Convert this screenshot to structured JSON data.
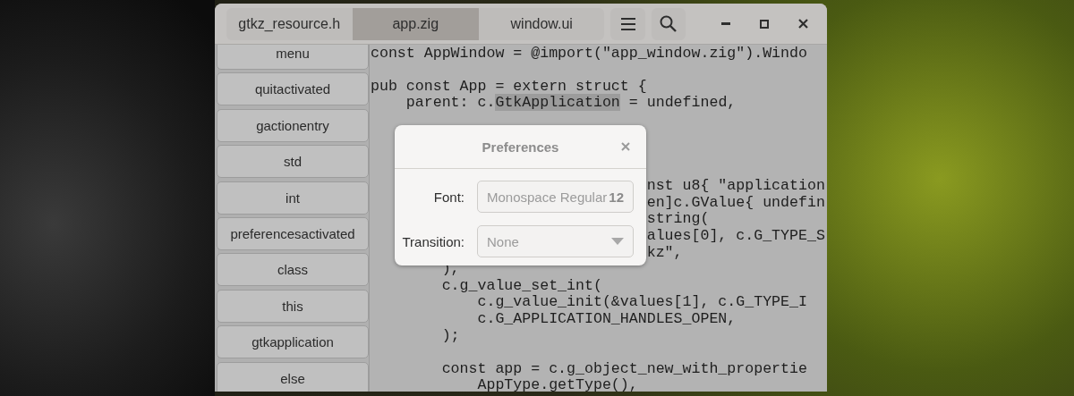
{
  "window": {
    "tabs": [
      {
        "label": "gtkz_resource.h",
        "selected": false
      },
      {
        "label": "app.zig",
        "selected": true
      },
      {
        "label": "window.ui",
        "selected": false
      }
    ]
  },
  "sidebar": {
    "items": [
      {
        "label": "menu"
      },
      {
        "label": "quitactivated"
      },
      {
        "label": "gactionentry"
      },
      {
        "label": "std"
      },
      {
        "label": "int"
      },
      {
        "label": "preferencesactivated"
      },
      {
        "label": "class"
      },
      {
        "label": "this"
      },
      {
        "label": "gtkapplication"
      },
      {
        "label": "else"
      }
    ]
  },
  "editor": {
    "lines": [
      {
        "kind": "text",
        "text": "const AppWindow = @import(\"app_window.zig\").Windo"
      },
      {
        "kind": "blank"
      },
      {
        "kind": "text",
        "text": "pub const App = extern struct {"
      },
      {
        "kind": "highlight",
        "before": "    parent: c.",
        "match": "GtkApplication",
        "after": " = undefined,"
      },
      {
        "kind": "hidden"
      },
      {
        "kind": "hidden"
      },
      {
        "kind": "hidden"
      },
      {
        "kind": "hidden"
      },
      {
        "kind": "partial",
        "text": "nst u8{ \"application"
      },
      {
        "kind": "partial",
        "text": "en]c.GValue{ undefin"
      },
      {
        "kind": "partial",
        "text": "string("
      },
      {
        "kind": "partial",
        "text": "alues[0], c.G_TYPE_S"
      },
      {
        "kind": "partial",
        "text": "kz\","
      },
      {
        "kind": "text",
        "text": "        ),"
      },
      {
        "kind": "text",
        "text": "        c.g_value_set_int("
      },
      {
        "kind": "text",
        "text": "            c.g_value_init(&values[1], c.G_TYPE_I"
      },
      {
        "kind": "text",
        "text": "            c.G_APPLICATION_HANDLES_OPEN,"
      },
      {
        "kind": "text",
        "text": "        );"
      },
      {
        "kind": "blank"
      },
      {
        "kind": "text",
        "text": "        const app = c.g_object_new_with_propertie"
      },
      {
        "kind": "text",
        "text": "            AppType.getType(),"
      }
    ]
  },
  "dialog": {
    "title": "Preferences",
    "rows": [
      {
        "kind": "font",
        "label": "Font:",
        "value": "Monospace Regular",
        "size": "12"
      },
      {
        "kind": "dropdown",
        "label": "Transition:",
        "value": "None"
      }
    ]
  }
}
